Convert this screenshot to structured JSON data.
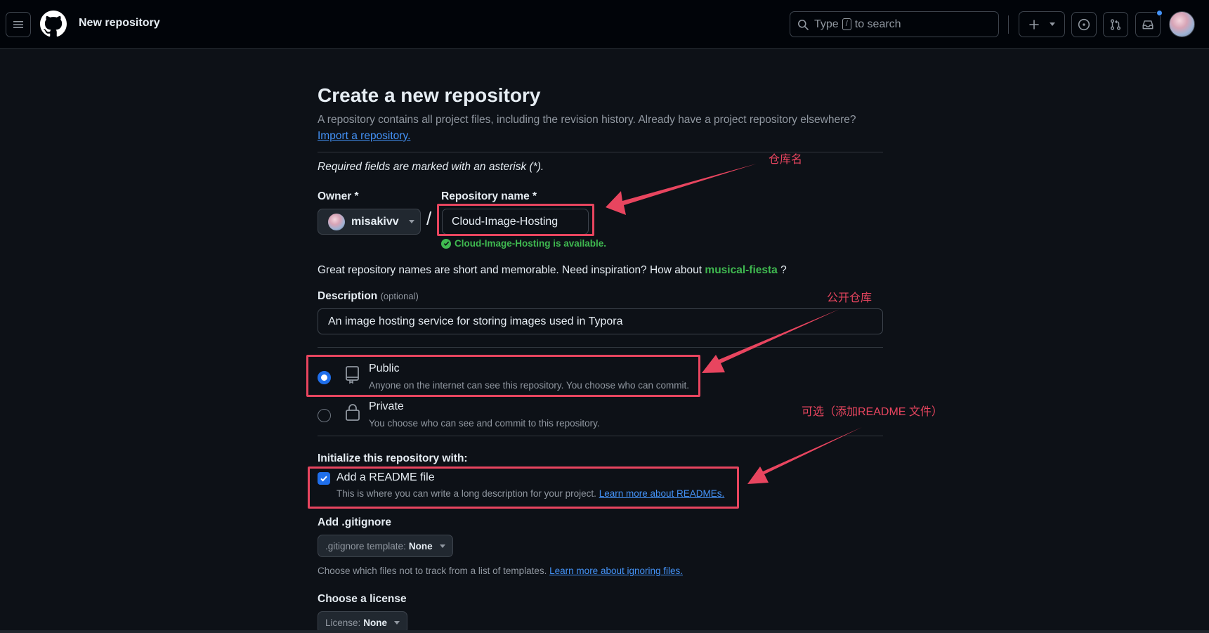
{
  "header": {
    "page_name": "New repository",
    "search_prefix": "Type",
    "search_key": "/",
    "search_suffix": "to search"
  },
  "form": {
    "title": "Create a new repository",
    "subtitle": "A repository contains all project files, including the revision history. Already have a project repository elsewhere?",
    "import_link": "Import a repository.",
    "required_note": "Required fields are marked with an asterisk (*).",
    "owner_label": "Owner *",
    "owner_value": "misakivv",
    "repo_label": "Repository name *",
    "repo_value": "Cloud-Image-Hosting",
    "available_text": "Cloud-Image-Hosting is available.",
    "suggest_prefix": "Great repository names are short and memorable. Need inspiration? How about",
    "suggest_name": "musical-fiesta",
    "suggest_suffix": "?",
    "description_label": "Description",
    "description_optional": "(optional)",
    "description_value": "An image hosting service for storing images used in Typora",
    "visibility": [
      {
        "title": "Public",
        "desc": "Anyone on the internet can see this repository. You choose who can commit.",
        "selected": true
      },
      {
        "title": "Private",
        "desc": "You choose who can see and commit to this repository.",
        "selected": false
      }
    ],
    "init_label": "Initialize this repository with:",
    "readme_title": "Add a README file",
    "readme_desc": "This is where you can write a long description for your project.",
    "readme_link": "Learn more about READMEs.",
    "readme_checked": true,
    "gitignore_label": "Add .gitignore",
    "gitignore_button_prefix": ".gitignore template:",
    "gitignore_button_value": "None",
    "gitignore_help": "Choose which files not to track from a list of templates.",
    "gitignore_link": "Learn more about ignoring files.",
    "license_label": "Choose a license",
    "license_button_prefix": "License:",
    "license_button_value": "None"
  },
  "annotations": {
    "repo_name_note": "仓库名",
    "public_note": "公开仓库",
    "readme_note": "可选（添加README 文件）",
    "color": "#e8455f"
  },
  "colors": {
    "background": "#0d1117",
    "header_bg": "#010409",
    "accent_blue": "#1f6feb",
    "link_blue": "#4493f8",
    "success_green": "#3fb950"
  }
}
